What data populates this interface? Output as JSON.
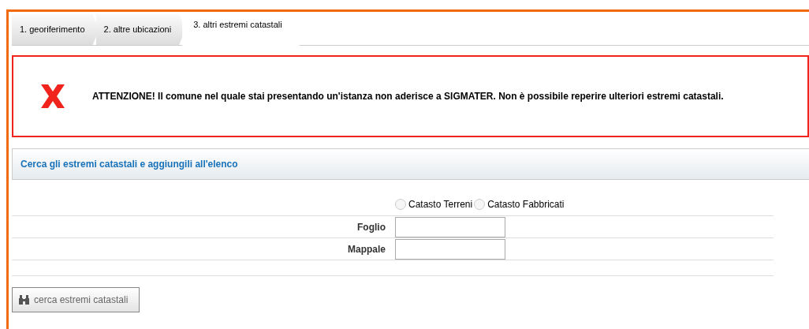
{
  "tabs": [
    {
      "label": "1. georiferimento",
      "selected": false
    },
    {
      "label": "2. altre ubicazioni",
      "selected": false
    },
    {
      "label": "3. altri estremi catastali",
      "selected": true
    }
  ],
  "alert": {
    "message": "ATTENZIONE! Il comune nel quale stai presentando un'istanza non aderisce a SIGMATER. Non è possibile reperire ulteriori estremi catastali."
  },
  "section": {
    "title": "Cerca gli estremi catastali e aggiungili all'elenco"
  },
  "radios": [
    {
      "label": "Catasto Terreni",
      "selected": false
    },
    {
      "label": "Catasto Fabbricati",
      "selected": false
    }
  ],
  "fields": [
    {
      "label": "Foglio"
    },
    {
      "label": "Mappale"
    }
  ],
  "button": {
    "label": "cerca estremi catastali"
  }
}
